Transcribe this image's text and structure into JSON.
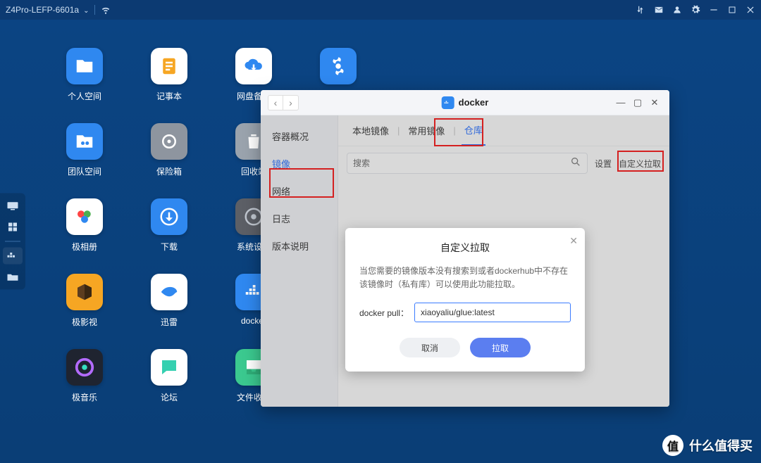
{
  "topbar": {
    "device": "Z4Pro-LEFP-6601a"
  },
  "desktop": {
    "apps": [
      {
        "label": "个人空间",
        "bg": "#2f88f0",
        "icon": "folder"
      },
      {
        "label": "记事本",
        "bg": "#ffffff",
        "icon": "note"
      },
      {
        "label": "网盘备份",
        "bg": "#ffffff",
        "icon": "cloud-down"
      },
      {
        "label": "",
        "bg": "#2f88f0",
        "icon": "fan"
      },
      {
        "label": "团队空间",
        "bg": "#2f88f0",
        "icon": "folder-team"
      },
      {
        "label": "保险箱",
        "bg": "#8e959f",
        "icon": "dial"
      },
      {
        "label": "回收站",
        "bg": "#9aa3ad",
        "icon": "trash"
      },
      {
        "label": "",
        "bg": "",
        "icon": ""
      },
      {
        "label": "极相册",
        "bg": "#ffffff",
        "icon": "photos"
      },
      {
        "label": "下载",
        "bg": "#2f88f0",
        "icon": "download"
      },
      {
        "label": "系统设置",
        "bg": "#5c5f66",
        "icon": "gear-circle"
      },
      {
        "label": "",
        "bg": "",
        "icon": ""
      },
      {
        "label": "极影视",
        "bg": "#f6a623",
        "icon": "cube"
      },
      {
        "label": "迅雷",
        "bg": "#ffffff",
        "icon": "bird"
      },
      {
        "label": "docker",
        "bg": "#2f88f0",
        "icon": "docker"
      },
      {
        "label": "",
        "bg": "",
        "icon": ""
      },
      {
        "label": "极音乐",
        "bg": "#1f2430",
        "icon": "music"
      },
      {
        "label": "论坛",
        "bg": "#ffffff",
        "icon": "chat"
      },
      {
        "label": "文件收集",
        "bg": "#3bc98f",
        "icon": "inbox"
      },
      {
        "label": "",
        "bg": "",
        "icon": ""
      }
    ]
  },
  "window": {
    "title": "docker",
    "sidebar": {
      "items": [
        "容器概况",
        "镜像",
        "网络",
        "日志",
        "版本说明"
      ],
      "activeIndex": 1
    },
    "tabs": {
      "items": [
        "本地镜像",
        "常用镜像",
        "仓库"
      ],
      "activeIndex": 2
    },
    "search": {
      "placeholder": "搜索"
    },
    "actions": {
      "settings": "设置",
      "custom_pull": "自定义拉取"
    }
  },
  "modal": {
    "title": "自定义拉取",
    "desc": "当您需要的镜像版本没有搜索到或者dockerhub中不存在该镜像时（私有库）可以使用此功能拉取。",
    "label": "docker pull：",
    "value": "xiaoyaliu/glue:latest",
    "btn_cancel": "取消",
    "btn_ok": "拉取"
  },
  "watermark": "什么值得买"
}
